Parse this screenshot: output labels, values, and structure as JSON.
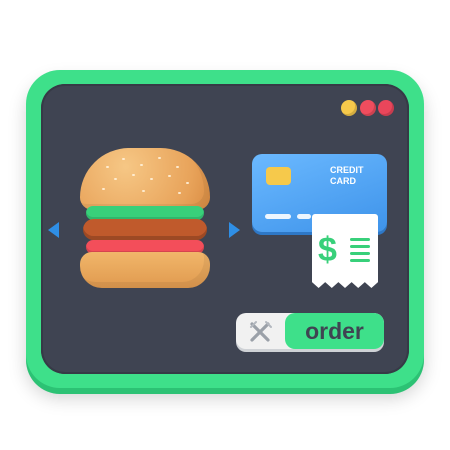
{
  "colors": {
    "frame": "#3ee08a",
    "screen": "#3f4452",
    "accent_blue": "#2f8fe6",
    "card_blue": "#4fa6f5",
    "receipt_green": "#38d07a"
  },
  "window_controls": [
    "minimize-dot",
    "maximize-dot",
    "close-dot"
  ],
  "burger": {
    "icon": "burger-icon"
  },
  "navigation": {
    "prev_icon": "arrow-left-icon",
    "next_icon": "arrow-right-icon"
  },
  "card": {
    "title_line1": "CREDIT",
    "title_line2": "CARD",
    "chip_icon": "card-chip-icon"
  },
  "receipt": {
    "symbol": "$",
    "icon": "receipt-icon"
  },
  "order": {
    "icon": "fork-knife-icon",
    "label": "order"
  }
}
